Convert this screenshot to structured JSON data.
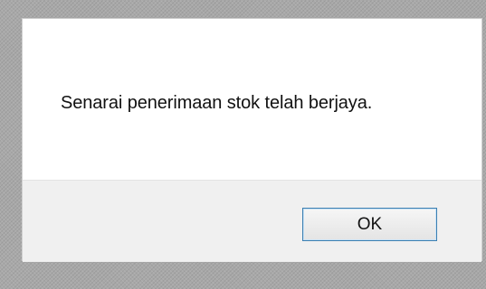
{
  "dialog": {
    "message": "Senarai penerimaan stok telah berjaya.",
    "ok_label": "OK"
  },
  "colors": {
    "backdrop": "#a8a8a8",
    "dialog_background": "#ffffff",
    "footer_background": "#f0f0f0",
    "button_border": "#3c7fb1"
  }
}
